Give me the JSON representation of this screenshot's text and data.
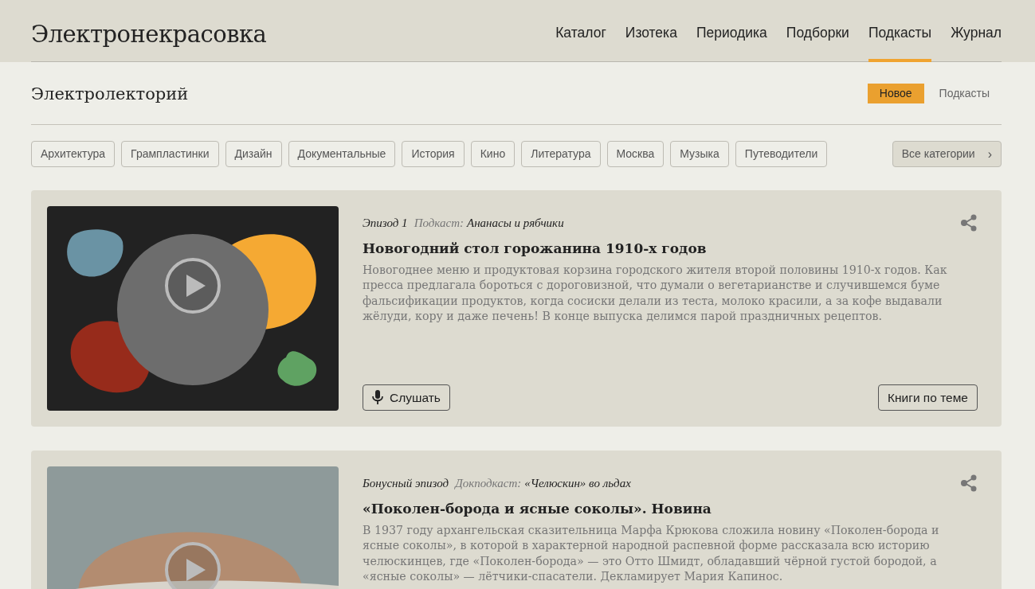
{
  "site": {
    "logo": "Электронекрасовка"
  },
  "nav": [
    {
      "label": "Каталог",
      "selected": false
    },
    {
      "label": "Изотека",
      "selected": false
    },
    {
      "label": "Периодика",
      "selected": false
    },
    {
      "label": "Подборки",
      "selected": false
    },
    {
      "label": "Подкасты",
      "selected": true
    },
    {
      "label": "Журнал",
      "selected": false
    }
  ],
  "section": {
    "title": "Электролекторий",
    "tabs": [
      {
        "label": "Новое",
        "selected": true
      },
      {
        "label": "Подкасты",
        "selected": false
      }
    ]
  },
  "categories": [
    "Архитектура",
    "Грампластинки",
    "Дизайн",
    "Документальные",
    "История",
    "Кино",
    "Литература",
    "Москва",
    "Музыка",
    "Путеводители"
  ],
  "all_categories": {
    "label": "Все категории",
    "chevron": "›"
  },
  "episodes": [
    {
      "cover": {
        "kind": "blobs"
      },
      "episode_label": "Эпизод 1",
      "podcast_label": "Подкаст:",
      "podcast_name": "Ананасы и рябчики",
      "title": "Новогодний стол горожанина 1910-х годов",
      "description": "Новогоднее меню и продуктовая корзина городского жителя второй половины 1910-х годов. Как пресса предлагала бороться с дороговизной, что думали о вегетарианстве и случившемся буме фальсификации продуктов, когда сосиски делали из теста, молоко красили, а за кофе выдавали жёлуди, кору и даже печень! В конце выпуска делимся парой праздничных рецептов.",
      "listen": "Слушать",
      "books": "Книги по теме"
    },
    {
      "cover": {
        "kind": "sunset"
      },
      "episode_label": "Бонусный эпизод",
      "podcast_label": "Докподкаст:",
      "podcast_name": "«Челюскин» во льдах",
      "title": "«Поколен-борода и ясные соколы». Новина",
      "description": "В 1937 году архангельская сказительница Марфа Крюкова сложила новину «Поколен-борода и ясные соколы», в которой в характерной народной распевной форме рассказала всю историю челюскинцев, где «Поколен-борода» — это Отто Шмидт, обладавший чёрной густой бородой, а «ясные соколы» — лётчики-спасатели. Декламирует Мария Капинос."
    }
  ]
}
